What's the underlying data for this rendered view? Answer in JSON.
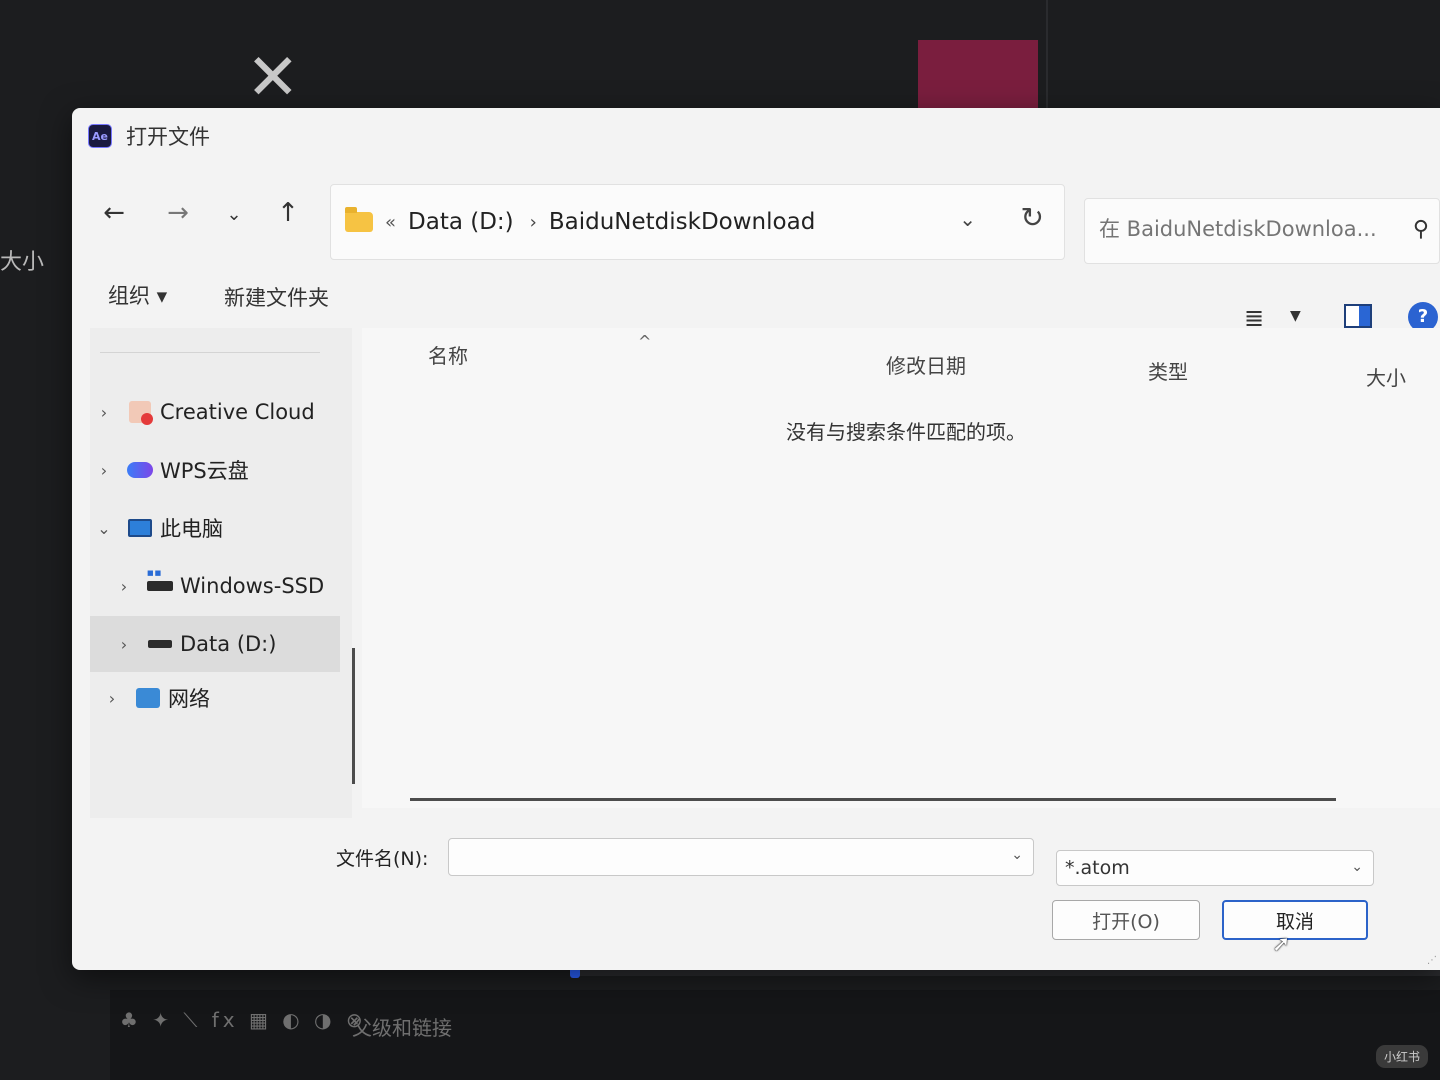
{
  "background": {
    "size_label": "大小",
    "toolbar_icons": "♣ ✦ ⟍ fx ▦ ◐ ◑ ⊗",
    "parent_link_label": "父级和链接",
    "watermark": "小红书"
  },
  "dialog": {
    "title": "打开文件",
    "app_badge": "Ae",
    "nav": {
      "back": "←",
      "forward": "→",
      "history": "⌄",
      "up": "↑"
    },
    "address": {
      "overflow": "«",
      "crumbs": [
        "Data (D:)",
        "BaiduNetdiskDownload"
      ],
      "separator": "›"
    },
    "search": {
      "placeholder": "在 BaiduNetdiskDownloa..."
    },
    "toolbar": {
      "organize": "组织 ▾",
      "new_folder": "新建文件夹"
    },
    "sidebar": {
      "items": [
        {
          "label": "Creative Cloud",
          "chevron": "›"
        },
        {
          "label": "WPS云盘",
          "chevron": "›"
        },
        {
          "label": "此电脑",
          "chevron": "⌄"
        },
        {
          "label": "Windows-SSD",
          "chevron": "›"
        },
        {
          "label": "Data (D:)",
          "chevron": "›"
        },
        {
          "label": "网络",
          "chevron": "›"
        }
      ]
    },
    "columns": {
      "name": "名称",
      "date": "修改日期",
      "type": "类型",
      "size": "大小"
    },
    "empty_message": "没有与搜索条件匹配的项。",
    "filename_label": "文件名(N):",
    "filename_value": "",
    "filetype_value": "*.atom",
    "open_button": "打开(O)",
    "cancel_button": "取消"
  }
}
